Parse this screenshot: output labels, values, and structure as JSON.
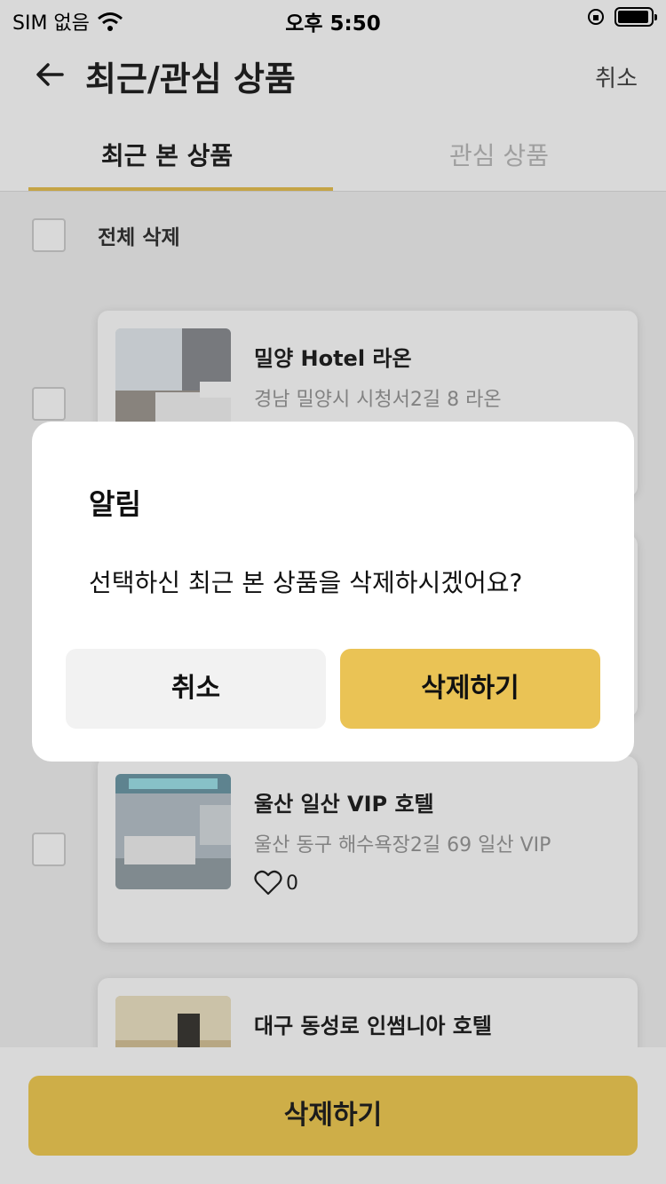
{
  "status_bar": {
    "carrier": "SIM 없음",
    "time": "오후 5:50"
  },
  "header": {
    "title": "최근/관심 상품",
    "cancel_label": "취소"
  },
  "tabs": [
    {
      "label": "최근 본 상품",
      "active": true
    },
    {
      "label": "관심 상품",
      "active": false
    }
  ],
  "select_all": {
    "label": "전체 삭제"
  },
  "items": [
    {
      "title": "밀양 Hotel 라온",
      "address": "경남 밀양시 시청서2길 8 라온",
      "likes": ""
    },
    {
      "title": "",
      "address": "",
      "likes": ""
    },
    {
      "title": "울산 일산 VIP 호텔",
      "address": "울산 동구 해수욕장2길 69 일산 VIP",
      "likes": "0"
    },
    {
      "title": "대구 동성로 인썸니아 호텔",
      "address": "",
      "likes": ""
    }
  ],
  "footer": {
    "delete_label": "삭제하기"
  },
  "dialog": {
    "title": "알림",
    "message": "선택하신 최근 본 상품을 삭제하시겠어요?",
    "cancel_label": "취소",
    "confirm_label": "삭제하기"
  },
  "colors": {
    "accent": "#EAC355",
    "overlay": "rgba(0,0,0,0.15)"
  }
}
